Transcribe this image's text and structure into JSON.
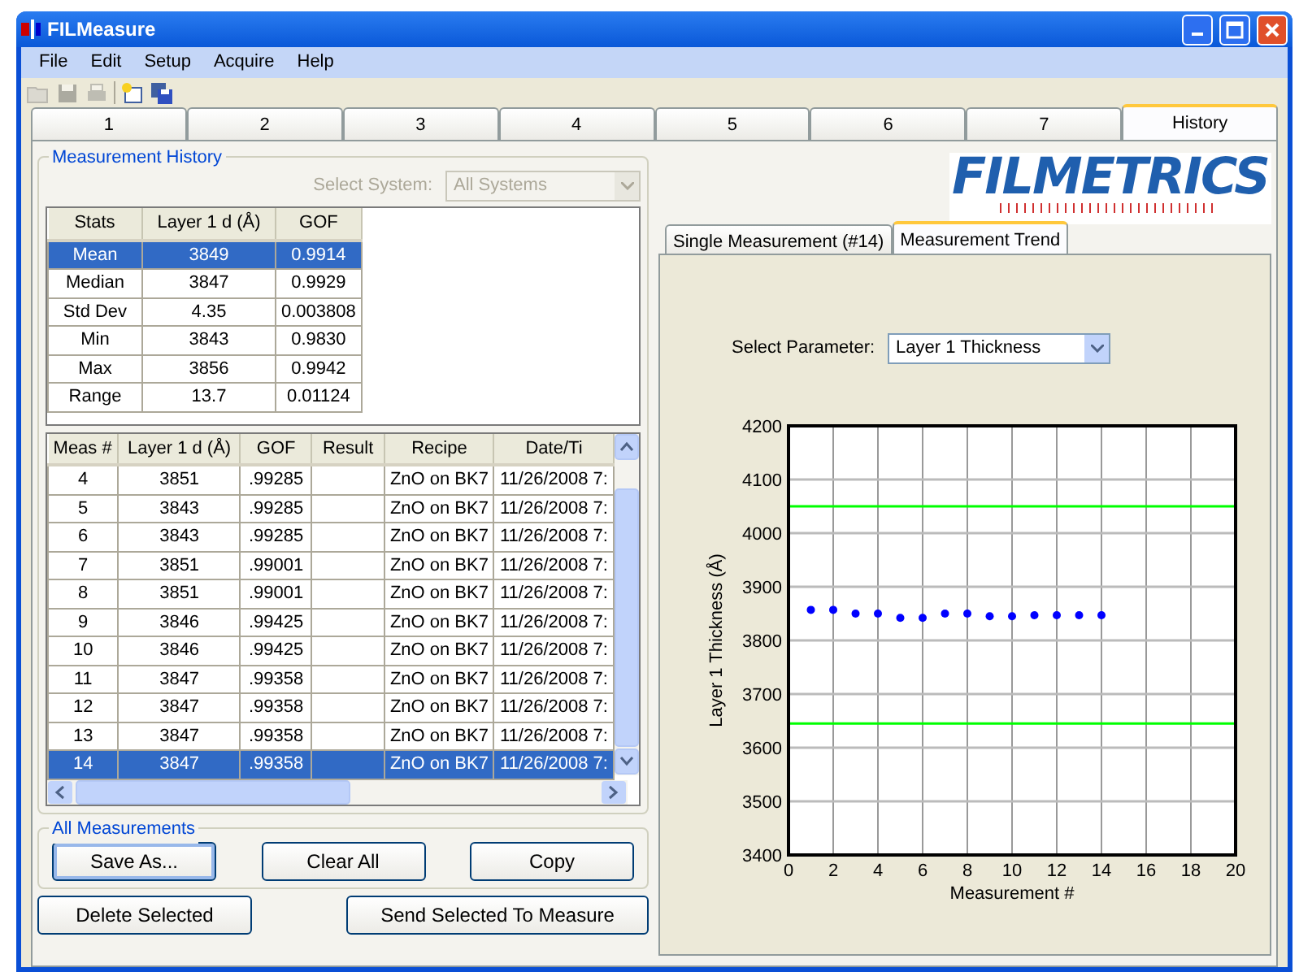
{
  "window": {
    "title": "FILMeasure"
  },
  "menu": [
    "File",
    "Edit",
    "Setup",
    "Acquire",
    "Help"
  ],
  "toolbar_buttons": [
    {
      "kind": "open",
      "disabled": true
    },
    {
      "kind": "save",
      "disabled": true
    },
    {
      "kind": "print",
      "disabled": true
    },
    {
      "kind": "new",
      "disabled": false
    },
    {
      "kind": "saveall",
      "disabled": false
    }
  ],
  "tabs": [
    {
      "label": "1",
      "selected": false
    },
    {
      "label": "2",
      "selected": false
    },
    {
      "label": "3",
      "selected": false
    },
    {
      "label": "4",
      "selected": false
    },
    {
      "label": "5",
      "selected": false
    },
    {
      "label": "6",
      "selected": false
    },
    {
      "label": "7",
      "selected": false
    },
    {
      "label": "History",
      "selected": true
    }
  ],
  "history": {
    "title": "Measurement History",
    "select_system": {
      "label": "Select System:",
      "value": "All Systems",
      "disabled": true
    },
    "stats": {
      "columns": [
        "Stats",
        "Layer 1 d (Å)",
        "GOF"
      ],
      "rows": [
        {
          "cells": [
            "Mean",
            "3849",
            "0.9914"
          ],
          "selected": true
        },
        {
          "cells": [
            "Median",
            "3847",
            "0.9929"
          ],
          "selected": false
        },
        {
          "cells": [
            "Std Dev",
            "4.35",
            "0.003808"
          ],
          "selected": false
        },
        {
          "cells": [
            "Min",
            "3843",
            "0.9830"
          ],
          "selected": false
        },
        {
          "cells": [
            "Max",
            "3856",
            "0.9942"
          ],
          "selected": false
        },
        {
          "cells": [
            "Range",
            "13.7",
            "0.01124"
          ],
          "selected": false
        }
      ]
    },
    "measurements": {
      "columns": [
        "Meas #",
        "Layer 1 d (Å)",
        "GOF",
        "Result",
        "Recipe",
        "Date/Ti"
      ],
      "rows": [
        {
          "meas": "4",
          "thickness": "3851",
          "gof": ".99285",
          "recipe": "ZnO on BK7",
          "date": "11/26/2008 7:",
          "selected": false
        },
        {
          "meas": "5",
          "thickness": "3843",
          "gof": ".99285",
          "recipe": "ZnO on BK7",
          "date": "11/26/2008 7:",
          "selected": false
        },
        {
          "meas": "6",
          "thickness": "3843",
          "gof": ".99285",
          "recipe": "ZnO on BK7",
          "date": "11/26/2008 7:",
          "selected": false
        },
        {
          "meas": "7",
          "thickness": "3851",
          "gof": ".99001",
          "recipe": "ZnO on BK7",
          "date": "11/26/2008 7:",
          "selected": false
        },
        {
          "meas": "8",
          "thickness": "3851",
          "gof": ".99001",
          "recipe": "ZnO on BK7",
          "date": "11/26/2008 7:",
          "selected": false
        },
        {
          "meas": "9",
          "thickness": "3846",
          "gof": ".99425",
          "recipe": "ZnO on BK7",
          "date": "11/26/2008 7:",
          "selected": false
        },
        {
          "meas": "10",
          "thickness": "3846",
          "gof": ".99425",
          "recipe": "ZnO on BK7",
          "date": "11/26/2008 7:",
          "selected": false
        },
        {
          "meas": "11",
          "thickness": "3847",
          "gof": ".99358",
          "recipe": "ZnO on BK7",
          "date": "11/26/2008 7:",
          "selected": false
        },
        {
          "meas": "12",
          "thickness": "3847",
          "gof": ".99358",
          "recipe": "ZnO on BK7",
          "date": "11/26/2008 7:",
          "selected": false
        },
        {
          "meas": "13",
          "thickness": "3847",
          "gof": ".99358",
          "recipe": "ZnO on BK7",
          "date": "11/26/2008 7:",
          "selected": false
        },
        {
          "meas": "14",
          "thickness": "3847",
          "gof": ".99358",
          "recipe": "ZnO on BK7",
          "date": "11/26/2008 7:",
          "selected": true
        }
      ]
    },
    "all_measurements": {
      "title": "All Measurements",
      "buttons": [
        {
          "label": "Save As...",
          "focused": true
        },
        {
          "label": "Clear All",
          "focused": false
        },
        {
          "label": "Copy",
          "focused": false
        }
      ]
    },
    "buttons": [
      "Delete Selected",
      "Send Selected To Measure"
    ]
  },
  "logo": "FILMETRICS",
  "inner_tabs": [
    {
      "label": "Single Measurement (#14)",
      "selected": false
    },
    {
      "label": "Measurement Trend",
      "selected": true
    }
  ],
  "trend": {
    "parameter_label": "Select Parameter:",
    "parameter_value": "Layer 1 Thickness",
    "chart_data": {
      "type": "scatter",
      "xlabel": "Measurement #",
      "ylabel": "Layer 1 Thickness (Å)",
      "xlim": [
        0,
        20
      ],
      "ylim": [
        3400,
        4200
      ],
      "xticks": [
        0,
        2,
        4,
        6,
        8,
        10,
        12,
        14,
        16,
        18,
        20
      ],
      "yticks": [
        3400,
        3500,
        3600,
        3700,
        3800,
        3900,
        4000,
        4100,
        4200
      ],
      "x": [
        1,
        2,
        3,
        4,
        5,
        6,
        7,
        8,
        9,
        10,
        11,
        12,
        13,
        14
      ],
      "grid": true,
      "series": [
        {
          "color": "#0000ff",
          "values": [
            3857,
            3857,
            3850,
            3850,
            3842,
            3842,
            3850,
            3850,
            3845,
            3845,
            3847,
            3847,
            3847,
            3847
          ]
        }
      ],
      "ref_lines": [
        {
          "axis": "y",
          "value": 4050,
          "color": "#00ff00"
        },
        {
          "axis": "y",
          "value": 3645,
          "color": "#00ff00"
        }
      ]
    }
  }
}
